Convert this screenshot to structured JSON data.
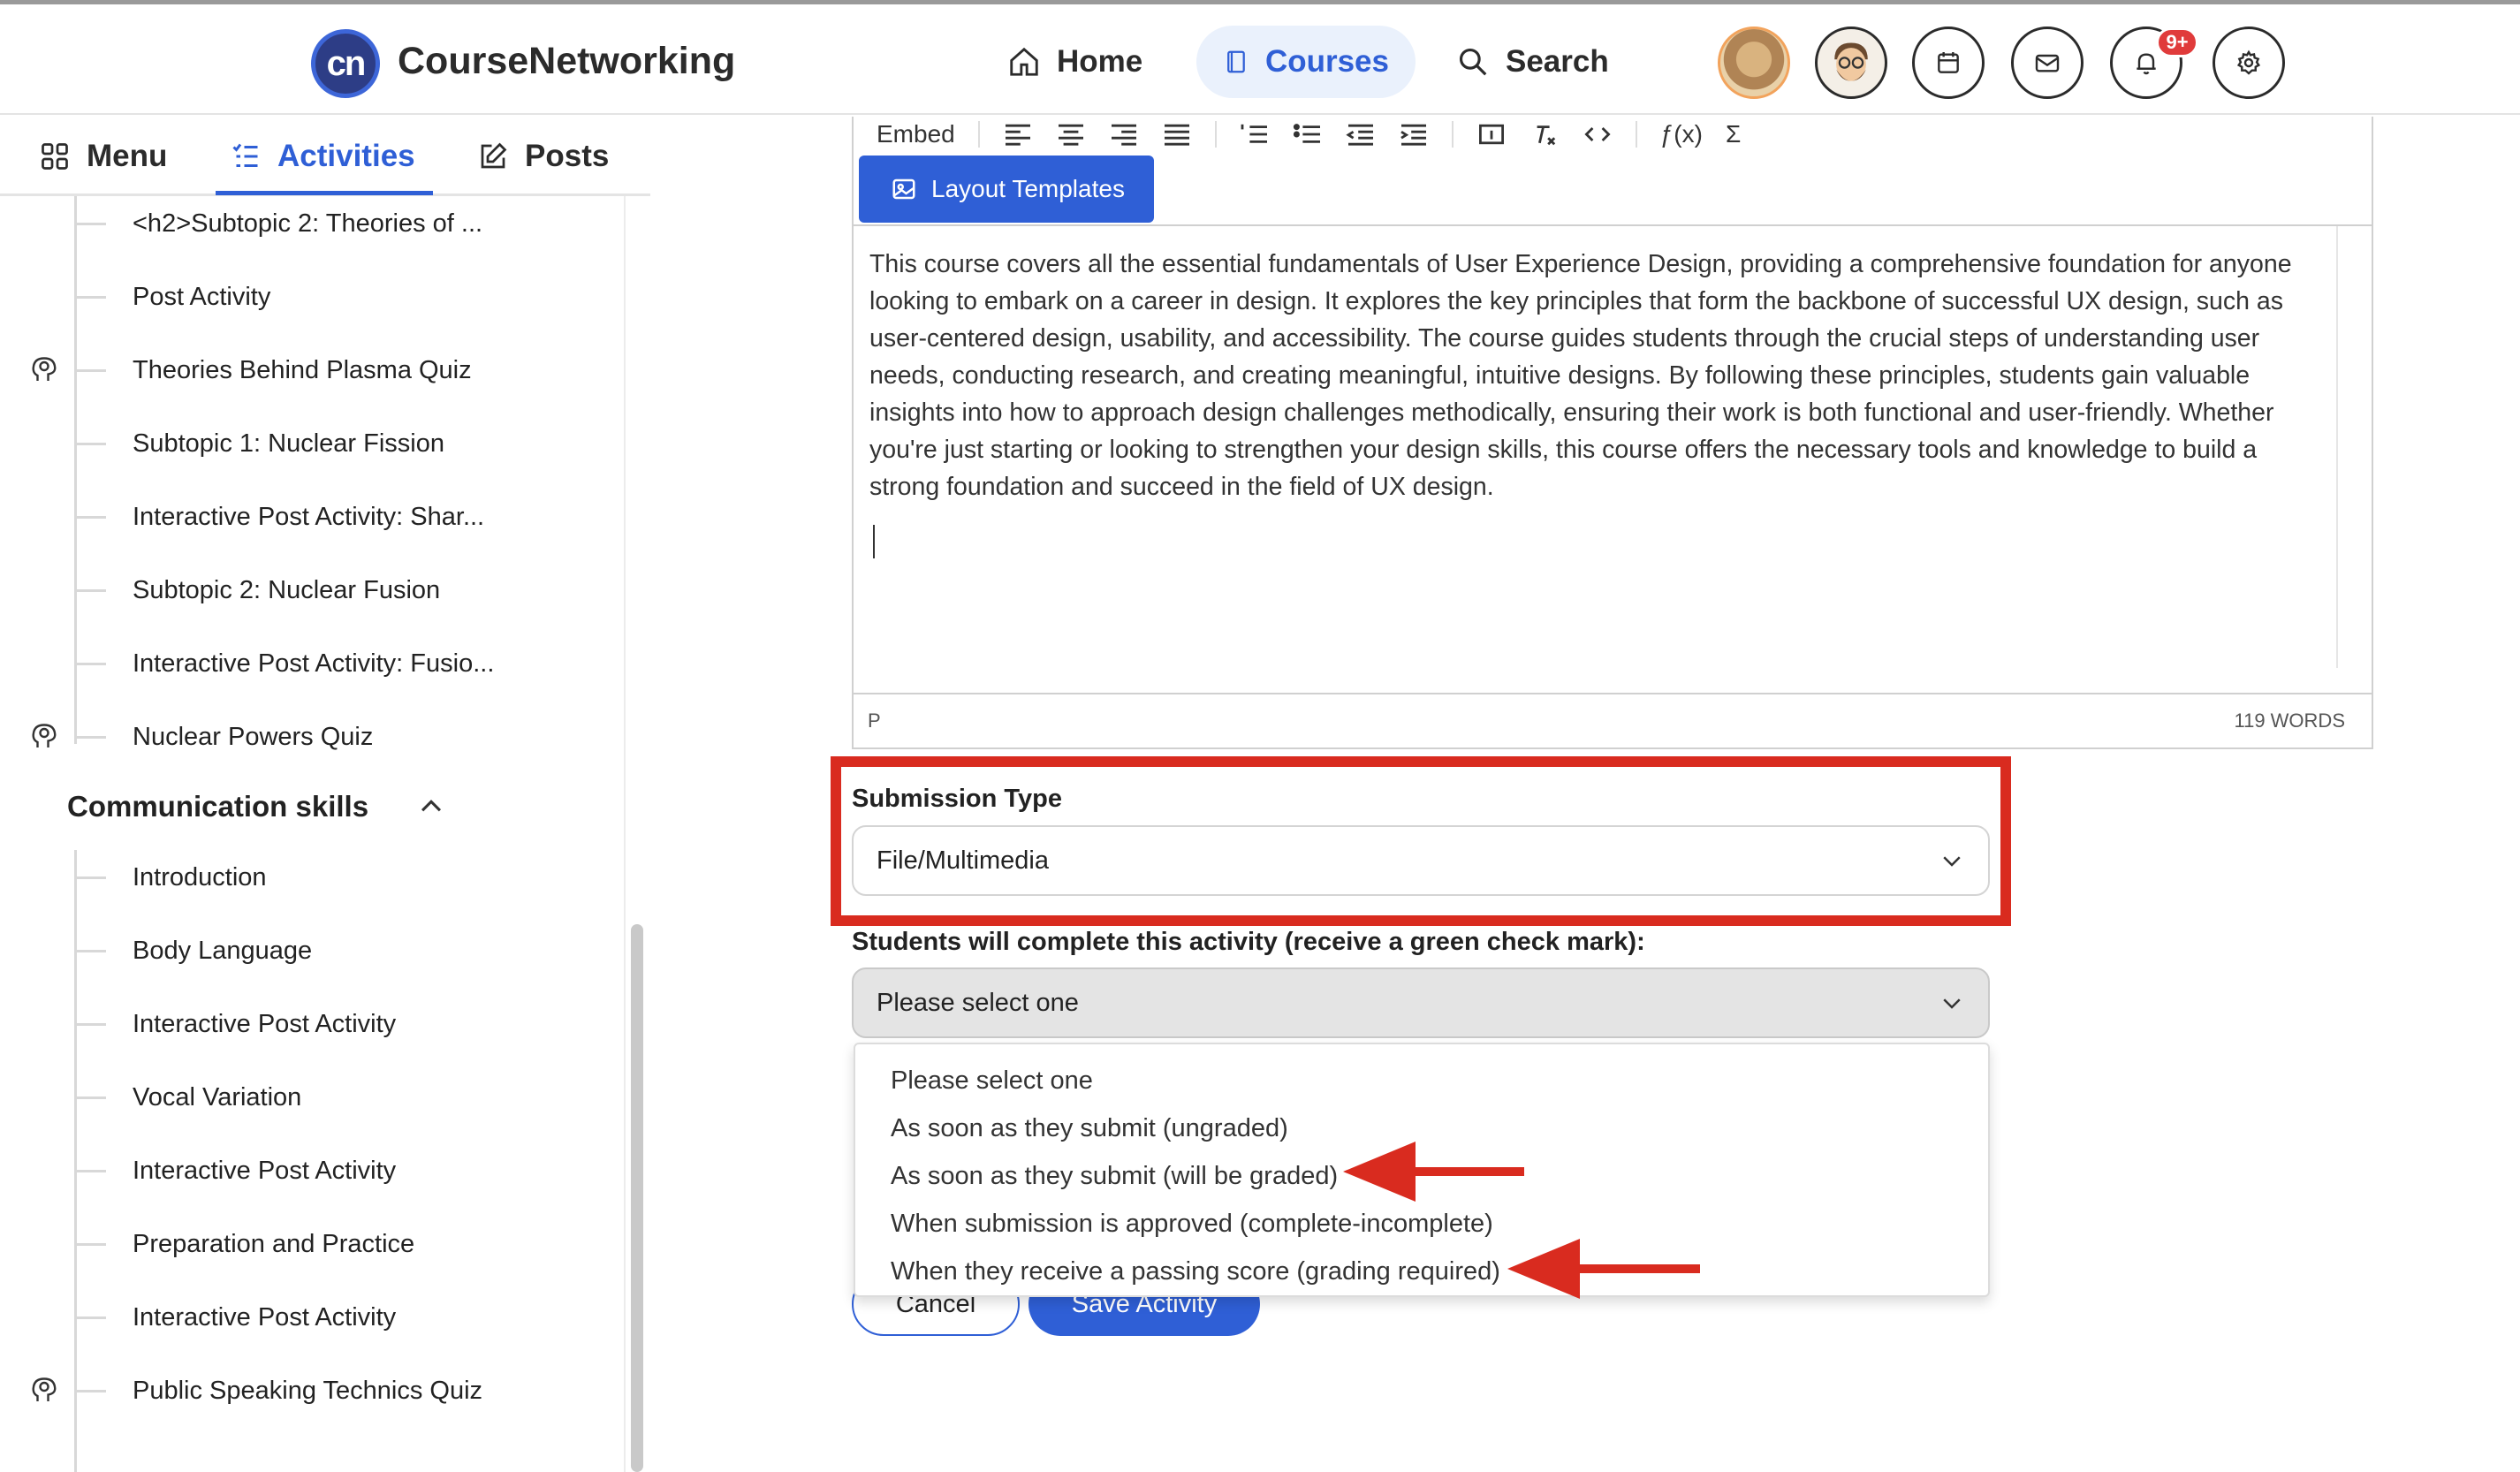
{
  "header": {
    "logo_text": "cn",
    "brand": "CourseNetworking",
    "nav": {
      "home": "Home",
      "courses": "Courses",
      "search": "Search"
    },
    "notification_badge": "9+",
    "icons": [
      "home-icon",
      "book-icon",
      "search-icon",
      "calendar-icon",
      "mail-icon",
      "bell-icon",
      "gear-icon"
    ]
  },
  "sidebar": {
    "tabs": {
      "menu": "Menu",
      "activities": "Activities",
      "posts": "Posts"
    },
    "items": [
      {
        "label": "<h2>Subtopic 2: Theories of ...",
        "quiz": false
      },
      {
        "label": "Post Activity",
        "quiz": false
      },
      {
        "label": "Theories Behind Plasma Quiz",
        "quiz": true
      },
      {
        "label": "Subtopic 1: Nuclear Fission",
        "quiz": false
      },
      {
        "label": "Interactive Post Activity: Shar...",
        "quiz": false
      },
      {
        "label": "Subtopic 2: Nuclear Fusion",
        "quiz": false
      },
      {
        "label": "Interactive Post Activity: Fusio...",
        "quiz": false
      },
      {
        "label": "Nuclear Powers Quiz",
        "quiz": true
      }
    ],
    "section_title": "Communication skills",
    "section_items": [
      {
        "label": "Introduction",
        "quiz": false
      },
      {
        "label": "Body Language",
        "quiz": false
      },
      {
        "label": "Interactive Post Activity",
        "quiz": false
      },
      {
        "label": "Vocal Variation",
        "quiz": false
      },
      {
        "label": "Interactive Post Activity",
        "quiz": false
      },
      {
        "label": "Preparation and Practice",
        "quiz": false
      },
      {
        "label": "Interactive Post Activity",
        "quiz": false
      },
      {
        "label": "Public Speaking Technics Quiz",
        "quiz": true
      }
    ]
  },
  "editor": {
    "toolbar": {
      "embed": "Embed",
      "fx": "ƒ(x)",
      "sigma": "Σ"
    },
    "layout_templates": "Layout Templates",
    "content": "This course covers all the essential fundamentals of User Experience Design, providing a comprehensive foundation for anyone looking to embark on a career in design. It explores the key principles that form the backbone of successful UX design, such as user-centered design, usability, and accessibility. The course guides students through the crucial steps of understanding user needs, conducting research, and creating meaningful, intuitive designs. By following these principles, students gain valuable insights into how to approach design challenges methodically, ensuring their work is both functional and user-friendly. Whether you're just starting or looking to strengthen your design skills, this course offers the necessary tools and knowledge to build a strong foundation and succeed in the field of UX design.",
    "element_path": "P",
    "word_count": "119 WORDS"
  },
  "form": {
    "submission_type_label": "Submission Type",
    "submission_type_value": "File/Multimedia",
    "completion_label": "Students will complete this activity (receive a green check mark):",
    "completion_value": "Please select one",
    "completion_options": [
      "Please select one",
      "As soon as they submit (ungraded)",
      "As soon as they submit (will be graded)",
      "When submission is approved (complete-incomplete)",
      "When they receive a passing score (grading required)"
    ],
    "cancel": "Cancel",
    "save": "Save Activity"
  },
  "colors": {
    "accent": "#2f5fd6",
    "highlight": "#d92b1f",
    "badge": "#e03b3b"
  }
}
